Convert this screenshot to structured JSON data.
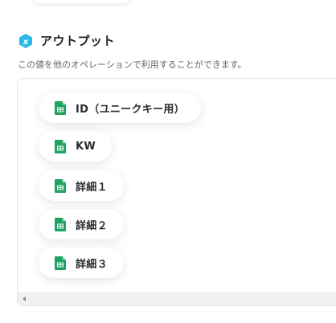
{
  "section": {
    "title": "アウトプット",
    "description": "この値を他のオペレーションで利用することができます。",
    "icon": "output-hexagon-icon",
    "icon_color": "#28b9e8"
  },
  "outputs": [
    {
      "label": "ID（ユニークキー用）",
      "icon": "spreadsheet-icon"
    },
    {
      "label": "KW",
      "icon": "spreadsheet-icon"
    },
    {
      "label": "詳細１",
      "icon": "spreadsheet-icon"
    },
    {
      "label": "詳細２",
      "icon": "spreadsheet-icon"
    },
    {
      "label": "詳細３",
      "icon": "spreadsheet-icon"
    }
  ],
  "colors": {
    "sheet_green": "#1ea362",
    "panel_border": "#e3e5e8"
  }
}
